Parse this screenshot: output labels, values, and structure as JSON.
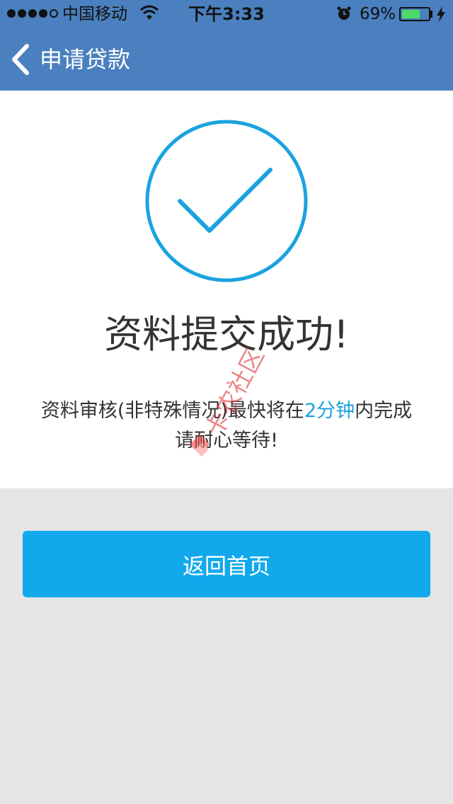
{
  "status_bar": {
    "carrier": "中国移动",
    "time": "下午3:33",
    "battery_percent": "69%",
    "battery_level": 0.69,
    "icons": [
      "signal-dots-icon",
      "wifi-icon",
      "alarm-icon",
      "battery-icon",
      "charging-bolt-icon"
    ]
  },
  "nav": {
    "back_icon": "chevron-left-icon",
    "title": "申请贷款"
  },
  "result": {
    "icon": "check-circle-icon",
    "title": "资料提交成功!",
    "line1_prefix": "资料审核(非特殊情况)最快将在",
    "line1_highlight": "2分钟",
    "line1_suffix": "内完成",
    "line2": "请耐心等待!"
  },
  "watermark": {
    "text": "卡农社区"
  },
  "actions": {
    "home_label": "返回首页"
  },
  "colors": {
    "header": "#4a80bf",
    "accent": "#1aa3e0",
    "button": "#12a9ec",
    "background": "#e5e5e5",
    "battery_fill": "#4cd964"
  }
}
